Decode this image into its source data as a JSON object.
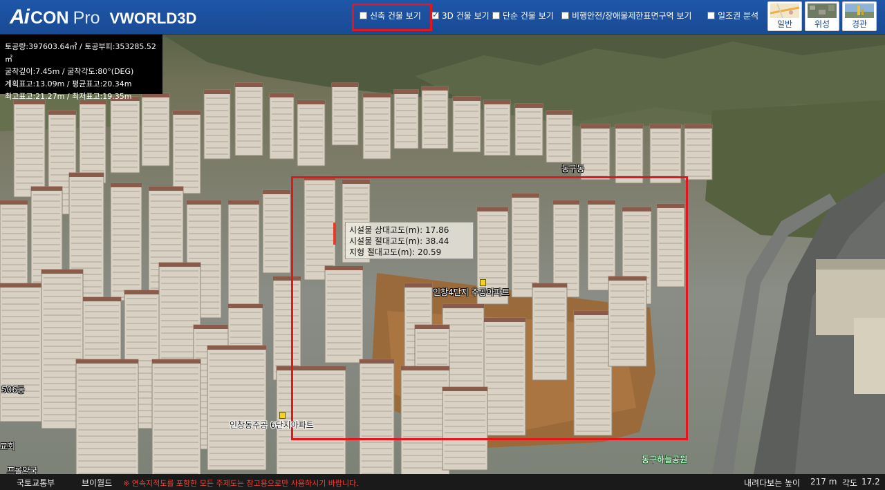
{
  "header": {
    "logo_mark": "Ai",
    "logo_con": "CON",
    "logo_pro": "Pro",
    "logo_title": "VWORLD3D",
    "options": [
      {
        "label": "신축 건물 보기",
        "checked": false
      },
      {
        "label": "3D 건물 보기",
        "checked": true
      },
      {
        "label": "단순 건물 보기",
        "checked": false
      },
      {
        "label": "비행안전/장애물제한표면구역 보기",
        "checked": false
      },
      {
        "label": "일조권 분석",
        "checked": false
      }
    ],
    "map_types": [
      {
        "label": "일반",
        "icon": "general-map-thumbnail"
      },
      {
        "label": "위성",
        "icon": "satellite-map-thumbnail"
      },
      {
        "label": "경관",
        "icon": "landscape-map-thumbnail"
      }
    ]
  },
  "info_panel": {
    "line1": "토공량:397603.64㎥ / 토공부피:353285.52㎡",
    "line2": "굴착깊이:7.45m / 굴착각도:80°(DEG)",
    "line3": "계획표고:13.09m / 평균표고:20.34m",
    "line4": "최고표고:21.27m / 최저표고:19.35m"
  },
  "tooltip": {
    "line1": "시설물 상대고도(m): 17.86",
    "line2": "시설물 절대고도(m): 38.44",
    "line3": "지형 절대고도(m): 20.59"
  },
  "places": {
    "apt4": "인창4단지 주공아파트",
    "apt6": "인창동주공 6단지아파트",
    "dong": "동구동",
    "dong506": "506동",
    "park": "동구하늘공원",
    "left_edge": "교회",
    "left_bottom": "프롤약국"
  },
  "footer": {
    "ministry": "국토교통부",
    "vworld": "브이월드",
    "warning": "※ 연속지적도를 포함한 모든 주제도는 참고용으로만 사용하시기 바랍니다.",
    "height_label": "내려다보는 높이",
    "height_value": "217 m",
    "angle_label": "각도",
    "angle_value": "17.2"
  },
  "colors": {
    "header_blue": "#1a4a94",
    "highlight_red": "#e8141b",
    "excavation_brown": "#9a6a3a"
  }
}
